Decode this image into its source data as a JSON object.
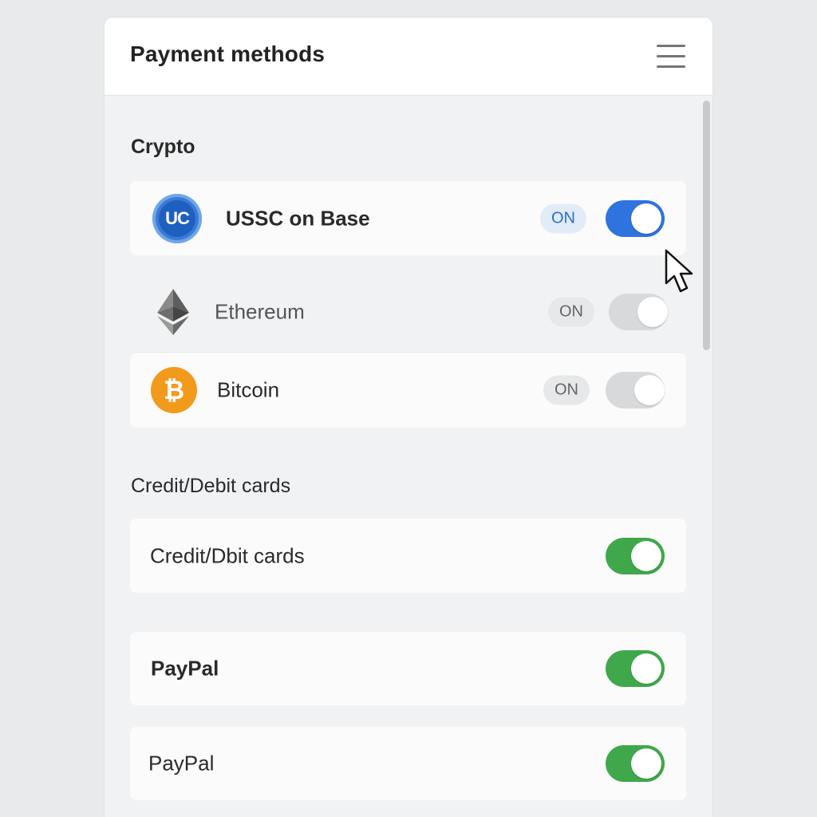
{
  "header": {
    "title": "Payment methods",
    "menu_icon": "hamburger-menu-icon"
  },
  "crypto": {
    "section_label": "Crypto",
    "items": [
      {
        "label": "USSC on Base",
        "icon": "ussc-coin-icon",
        "icon_text": "UC",
        "status": "ON",
        "toggle_on": true,
        "accent": "#2f73de"
      },
      {
        "label": "Ethereum",
        "icon": "ethereum-icon",
        "status": "ON",
        "toggle_on": false
      },
      {
        "label": "Bitcoin",
        "icon": "bitcoin-icon",
        "icon_text": "₿",
        "status": "ON",
        "toggle_on": false,
        "accent": "#f29a1c"
      }
    ]
  },
  "cards": {
    "section_label": "Credit/Debit cards",
    "items": [
      {
        "label": "Credit/Dbit cards",
        "toggle_on": true,
        "accent": "#3fa84b"
      }
    ]
  },
  "other": {
    "items": [
      {
        "label": "PayPal",
        "toggle_on": true,
        "accent": "#3fa84b"
      },
      {
        "label": "PayPal",
        "toggle_on": true,
        "accent": "#3fa84b"
      }
    ]
  }
}
